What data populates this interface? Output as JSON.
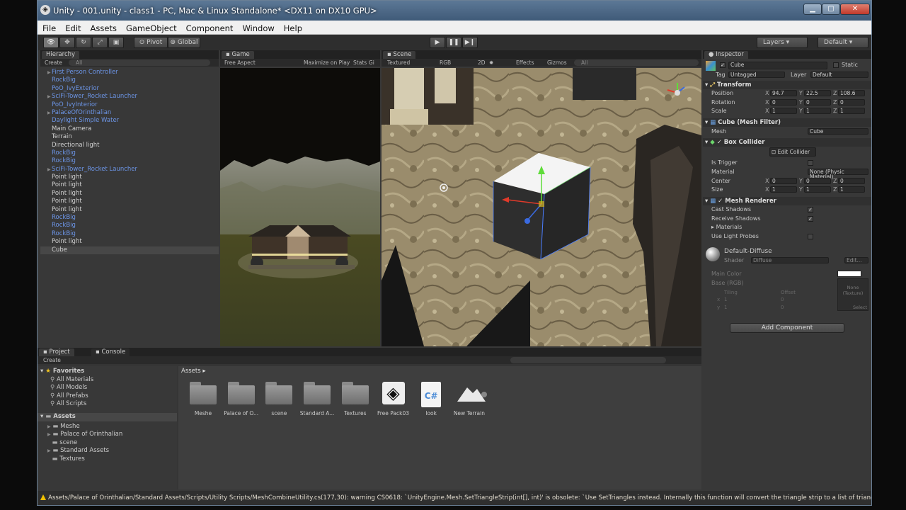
{
  "window": {
    "title": "Unity - 001.unity - class1 - PC, Mac & Linux Standalone* <DX11 on DX10 GPU>"
  },
  "menu": [
    "File",
    "Edit",
    "Assets",
    "GameObject",
    "Component",
    "Window",
    "Help"
  ],
  "toolbar": {
    "pivot": "Pivot",
    "global": "Global",
    "layers": "Layers",
    "layout": "Default"
  },
  "hierarchy": {
    "tab": "Hierarchy",
    "create": "Create",
    "search": "All",
    "items": [
      {
        "name": "First Person Controller",
        "prefab": true,
        "arrow": true
      },
      {
        "name": "RockBig",
        "prefab": true
      },
      {
        "name": "PoO_IvyExterior",
        "prefab": true
      },
      {
        "name": "SciFi-Tower_Rocket Launcher",
        "prefab": true,
        "arrow": true
      },
      {
        "name": "PoO_IvyInterior",
        "prefab": true
      },
      {
        "name": "PalaceOfOrinthalian",
        "prefab": true,
        "arrow": true
      },
      {
        "name": "Daylight Simple Water",
        "prefab": true
      },
      {
        "name": "Main Camera",
        "prefab": false
      },
      {
        "name": "Terrain",
        "prefab": false
      },
      {
        "name": "Directional light",
        "prefab": false
      },
      {
        "name": "RockBig",
        "prefab": true
      },
      {
        "name": "RockBig",
        "prefab": true
      },
      {
        "name": "SciFi-Tower_Rocket Launcher",
        "prefab": true,
        "arrow": true
      },
      {
        "name": "Point light",
        "prefab": false
      },
      {
        "name": "Point light",
        "prefab": false
      },
      {
        "name": "Point light",
        "prefab": false
      },
      {
        "name": "Point light",
        "prefab": false
      },
      {
        "name": "Point light",
        "prefab": false
      },
      {
        "name": "RockBig",
        "prefab": true
      },
      {
        "name": "RockBig",
        "prefab": true
      },
      {
        "name": "RockBig",
        "prefab": true
      },
      {
        "name": "Point light",
        "prefab": false
      },
      {
        "name": "Cube",
        "prefab": false,
        "selected": true
      }
    ]
  },
  "game": {
    "tab": "Game",
    "aspect": "Free Aspect",
    "maximize": "Maximize on Play",
    "stats": "Stats",
    "gizmos": "Gizmos"
  },
  "scene": {
    "tab": "Scene",
    "mode": "Textured",
    "rgb": "RGB",
    "two_d": "2D",
    "effects": "Effects",
    "gizmos": "Gizmos",
    "search": "All"
  },
  "inspector": {
    "tab": "Inspector",
    "object": "Cube",
    "static": "Static",
    "tag_label": "Tag",
    "tag": "Untagged",
    "layer_label": "Layer",
    "layer": "Default",
    "transform": {
      "title": "Transform",
      "rows": [
        {
          "label": "Position",
          "x": "94.7",
          "y": "22.5",
          "z": "108.6"
        },
        {
          "label": "Rotation",
          "x": "0",
          "y": "0",
          "z": "0"
        },
        {
          "label": "Scale",
          "x": "1",
          "y": "1",
          "z": "1"
        }
      ]
    },
    "mesh_filter": {
      "title": "Cube (Mesh Filter)",
      "mesh_label": "Mesh",
      "mesh": "Cube"
    },
    "box_collider": {
      "title": "Box Collider",
      "edit": "Edit Collider",
      "is_trigger": "Is Trigger",
      "material_label": "Material",
      "material": "None (Physic Material)",
      "center": {
        "label": "Center",
        "x": "0",
        "y": "0",
        "z": "0"
      },
      "size": {
        "label": "Size",
        "x": "1",
        "y": "1",
        "z": "1"
      }
    },
    "mesh_renderer": {
      "title": "Mesh Renderer",
      "cast": "Cast Shadows",
      "receive": "Receive Shadows",
      "materials": "Materials",
      "light_probes": "Use Light Probes"
    },
    "material": {
      "title": "Default-Diffuse",
      "shader_label": "Shader",
      "shader": "Diffuse",
      "edit": "Edit...",
      "main_color": "Main Color",
      "base": "Base (RGB)",
      "tiling": "Tiling",
      "offset": "Offset",
      "x_label": "x",
      "y_label": "y",
      "tx": "1",
      "ty": "1",
      "ox": "0",
      "oy": "0",
      "none": "None",
      "texture": "(Texture)",
      "select": "Select"
    },
    "add_component": "Add Component"
  },
  "project": {
    "tab": "Project",
    "console": "Console",
    "create": "Create",
    "breadcrumb": "Assets",
    "favorites": {
      "title": "Favorites",
      "items": [
        "All Materials",
        "All Models",
        "All Prefabs",
        "All Scripts"
      ]
    },
    "assets_root": "Assets",
    "folders": [
      "Meshe",
      "Palace of Orinthalian",
      "scene",
      "Standard Assets",
      "Textures"
    ],
    "files": [
      {
        "name": "Meshe",
        "kind": "folder"
      },
      {
        "name": "Palace of O...",
        "kind": "folder"
      },
      {
        "name": "scene",
        "kind": "folder"
      },
      {
        "name": "Standard A...",
        "kind": "folder"
      },
      {
        "name": "Textures",
        "kind": "folder"
      },
      {
        "name": "Free Pack03",
        "kind": "unity"
      },
      {
        "name": "look",
        "kind": "csharp"
      },
      {
        "name": "New Terrain",
        "kind": "terrain"
      }
    ]
  },
  "status": {
    "message": "Assets/Palace of Orinthalian/Standard Assets/Scripts/Utility Scripts/MeshCombineUtility.cs(177,30): warning CS0618: `UnityEngine.Mesh.SetTriangleStrip(int[], int)' is obsolete: `Use SetTriangles instead. Internally this function will convert the triangle strip to a list of triangles anyway.'"
  }
}
